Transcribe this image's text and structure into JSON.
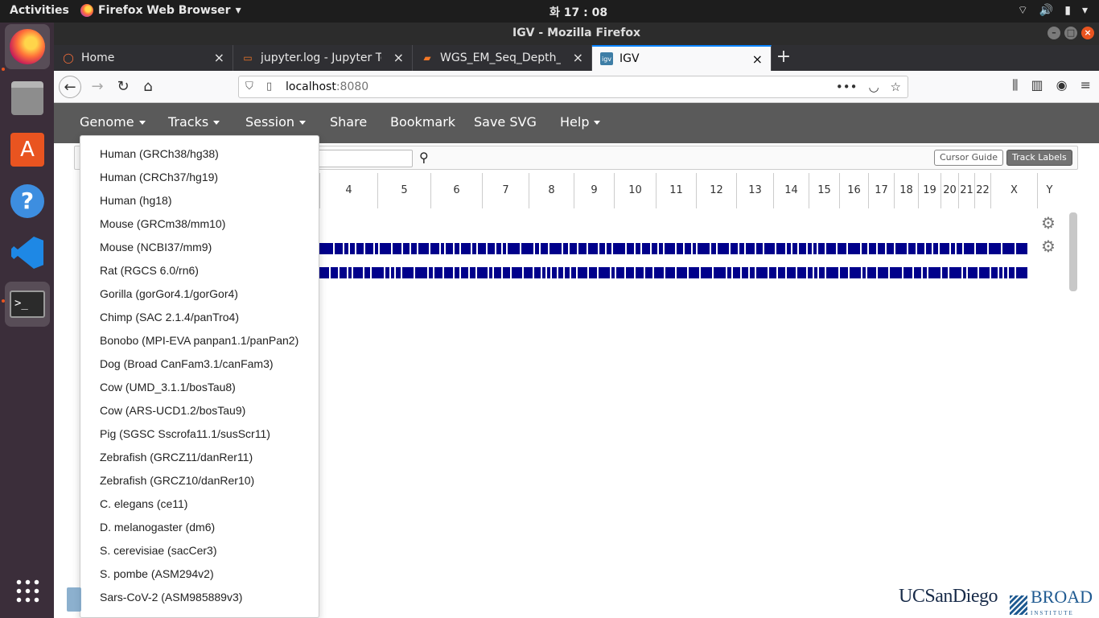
{
  "topbar": {
    "activities": "Activities",
    "app_name": "Firefox Web Browser",
    "clock": "화 17 : 08"
  },
  "dock": {
    "icons": [
      "firefox-icon",
      "files-icon",
      "software-icon",
      "help-icon",
      "vscode-icon",
      "terminal-icon",
      "show-apps-icon"
    ]
  },
  "window": {
    "title": "IGV - Mozilla Firefox"
  },
  "tabs": [
    {
      "label": "Home",
      "icon": "firefox-icon",
      "active": false
    },
    {
      "label": "jupyter.log - Jupyter Text",
      "icon": "file-icon",
      "active": false
    },
    {
      "label": "WGS_EM_Seq_Depth_Vi",
      "icon": "book-icon",
      "active": false
    },
    {
      "label": "IGV",
      "icon": "igv-icon",
      "active": true
    }
  ],
  "url": {
    "host": "localhost",
    "port": ":8080"
  },
  "igv": {
    "menus": {
      "genome": "Genome",
      "tracks": "Tracks",
      "session": "Session",
      "share": "Share",
      "bookmark": "Bookmark",
      "save_svg": "Save SVG",
      "help": "Help"
    },
    "cursor_guide": "Cursor Guide",
    "track_labels": "Track Labels",
    "chromosomes": [
      "4",
      "5",
      "6",
      "7",
      "8",
      "9",
      "10",
      "11",
      "12",
      "13",
      "14",
      "15",
      "16",
      "17",
      "18",
      "19",
      "20",
      "21",
      "22",
      "X",
      "Y"
    ]
  },
  "genome_menu": [
    "Human (GRCh38/hg38)",
    "Human (CRCh37/hg19)",
    "Human (hg18)",
    "Mouse (GRCm38/mm10)",
    "Mouse (NCBI37/mm9)",
    "Rat (RGCS 6.0/rn6)",
    "Gorilla (gorGor4.1/gorGor4)",
    "Chimp (SAC 2.1.4/panTro4)",
    "Bonobo (MPI-EVA panpan1.1/panPan2)",
    "Dog (Broad CanFam3.1/canFam3)",
    "Cow (UMD_3.1.1/bosTau8)",
    "Cow (ARS-UCD1.2/bosTau9)",
    "Pig (SGSC Sscrofa11.1/susScr11)",
    "Zebrafish (GRCZ11/danRer11)",
    "Zebrafish (GRCZ10/danRer10)",
    "C. elegans (ce11)",
    "D. melanogaster (dm6)",
    "S. cerevisiae (sacCer3)",
    "S. pombe (ASM294v2)",
    "Sars-CoV-2 (ASM985889v3)"
  ],
  "footer": {
    "ucsd": "UCSanDiego",
    "broad": "BROAD",
    "broad_sub": "INSTITUTE"
  }
}
